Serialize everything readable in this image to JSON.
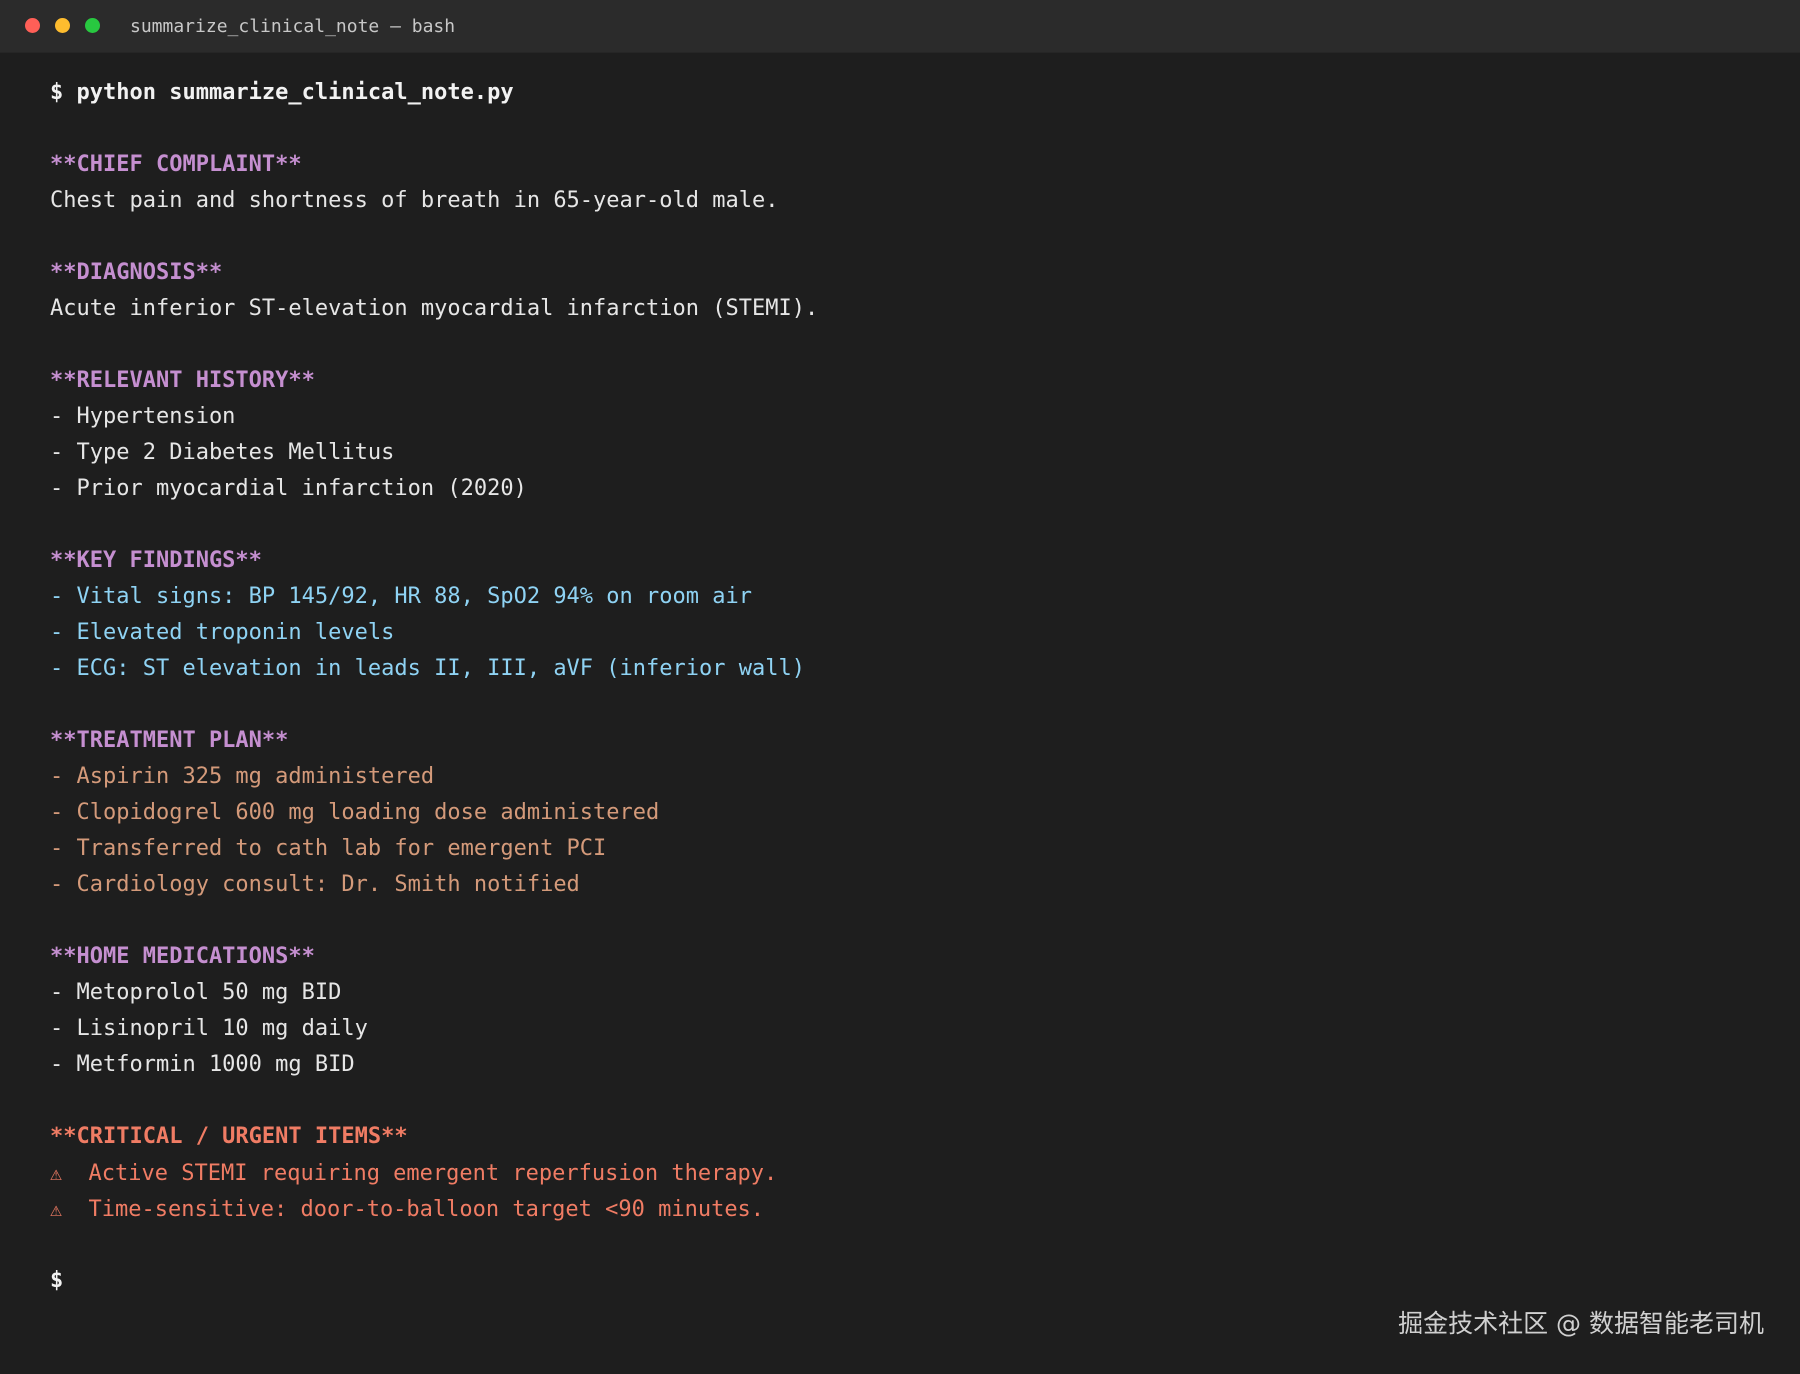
{
  "window": {
    "title": "summarize_clinical_note — bash",
    "colors": {
      "background": "#1e1e1e",
      "titlebar": "#2b2b2b",
      "close": "#ff5f57",
      "minimize": "#febc2e",
      "maximize": "#28c840"
    }
  },
  "terminal": {
    "command": "$ python summarize_clinical_note.py",
    "chief_complaint": {
      "heading": "**CHIEF COMPLAINT**",
      "text": "Chest pain and shortness of breath in 65-year-old male."
    },
    "diagnosis": {
      "heading": "**DIAGNOSIS**",
      "text": "Acute inferior ST-elevation myocardial infarction (STEMI)."
    },
    "history": {
      "heading": "**RELEVANT HISTORY**",
      "items": [
        "- Hypertension",
        "- Type 2 Diabetes Mellitus",
        "- Prior myocardial infarction (2020)"
      ]
    },
    "findings": {
      "heading": "**KEY FINDINGS**",
      "items": [
        "- Vital signs: BP 145/92, HR 88, SpO2 94% on room air",
        "- Elevated troponin levels",
        "- ECG: ST elevation in leads II, III, aVF (inferior wall)"
      ]
    },
    "treatment": {
      "heading": "**TREATMENT PLAN**",
      "items": [
        "- Aspirin 325 mg administered",
        "- Clopidogrel 600 mg loading dose administered",
        "- Transferred to cath lab for emergent PCI",
        "- Cardiology consult: Dr. Smith notified"
      ]
    },
    "medications": {
      "heading": "**HOME MEDICATIONS**",
      "items": [
        "- Metoprolol 50 mg BID",
        "- Lisinopril 10 mg daily",
        "- Metformin 1000 mg BID"
      ]
    },
    "critical": {
      "heading": "**CRITICAL / URGENT ITEMS**",
      "icon": "⚠",
      "items": [
        "Active STEMI requiring emergent reperfusion therapy.",
        "Time-sensitive: door-to-balloon target <90 minutes."
      ]
    },
    "prompt": "$"
  },
  "watermark": "掘金技术社区 @ 数据智能老司机"
}
